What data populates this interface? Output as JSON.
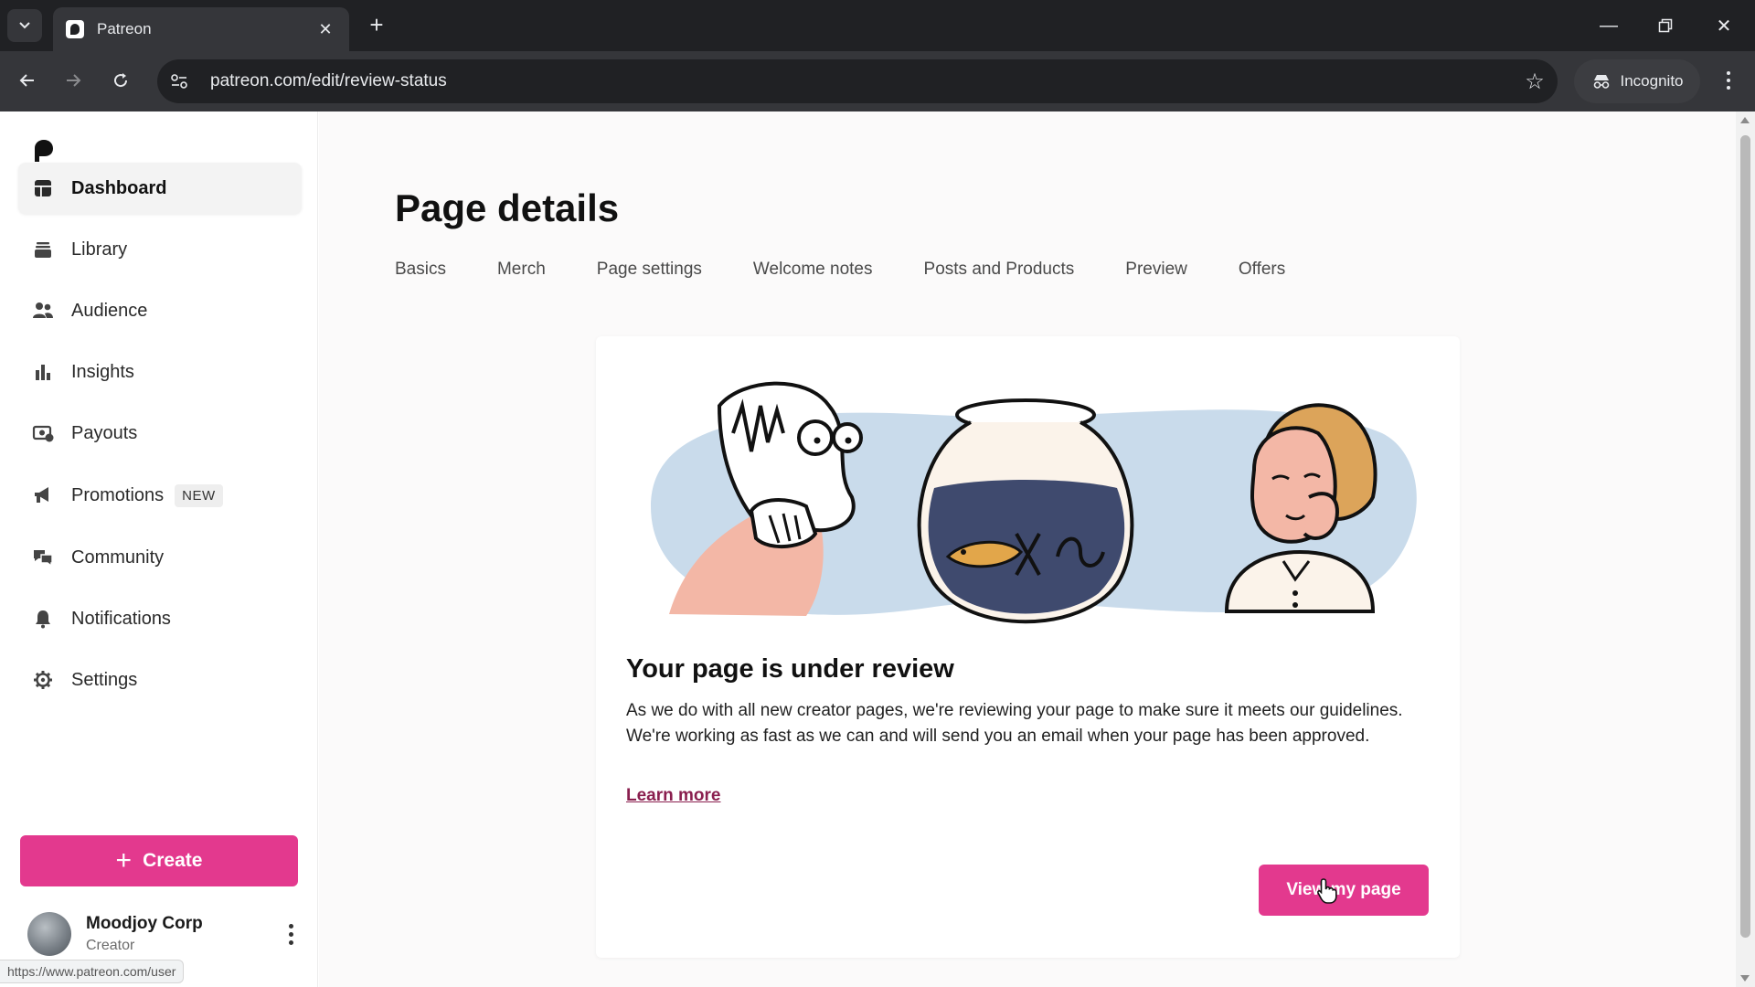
{
  "browser": {
    "tab_title": "Patreon",
    "url": "patreon.com/edit/review-status",
    "incognito_label": "Incognito",
    "status_url": "https://www.patreon.com/user"
  },
  "sidebar": {
    "items": [
      {
        "label": "Dashboard",
        "icon": "dashboard-icon"
      },
      {
        "label": "Library",
        "icon": "library-icon"
      },
      {
        "label": "Audience",
        "icon": "audience-icon"
      },
      {
        "label": "Insights",
        "icon": "insights-icon"
      },
      {
        "label": "Payouts",
        "icon": "payouts-icon"
      },
      {
        "label": "Promotions",
        "icon": "promotions-icon",
        "badge": "NEW"
      },
      {
        "label": "Community",
        "icon": "community-icon"
      },
      {
        "label": "Notifications",
        "icon": "bell-icon"
      },
      {
        "label": "Settings",
        "icon": "gear-icon"
      }
    ],
    "create_label": "Create",
    "user": {
      "name": "Moodjoy Corp",
      "role": "Creator"
    }
  },
  "main": {
    "title": "Page details",
    "tabs": [
      "Basics",
      "Merch",
      "Page settings",
      "Welcome notes",
      "Posts and Products",
      "Preview",
      "Offers"
    ],
    "card": {
      "title": "Your page is under review",
      "body": "As we do with all new creator pages, we're reviewing your page to make sure it meets our guidelines. We're working as fast as we can and will send you an email when your page has been approved.",
      "learn_more": "Learn more",
      "button": "View my page"
    }
  },
  "colors": {
    "accent": "#e3398e",
    "link": "#8a1f4f",
    "chrome_dark": "#202124",
    "chrome_mid": "#35363a"
  }
}
